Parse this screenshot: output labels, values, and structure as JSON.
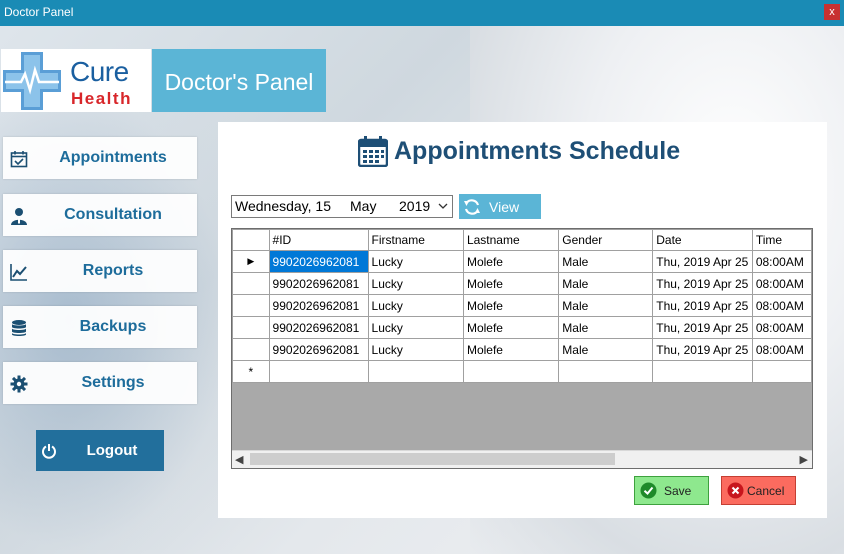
{
  "window": {
    "title": "Doctor Panel",
    "close_glyph": "x"
  },
  "logo": {
    "line1": "Cure",
    "line2": "Health",
    "icon": "medical-cross-heartbeat-icon"
  },
  "header": {
    "title": "Doctor's Panel"
  },
  "nav": {
    "items": [
      {
        "label": "Appointments",
        "icon": "calendar-check-icon"
      },
      {
        "label": "Consultation",
        "icon": "user-doctor-icon"
      },
      {
        "label": "Reports",
        "icon": "line-chart-icon"
      },
      {
        "label": "Backups",
        "icon": "database-icon"
      },
      {
        "label": "Settings",
        "icon": "gear-icon"
      }
    ],
    "logout": {
      "label": "Logout",
      "icon": "power-icon"
    }
  },
  "main": {
    "heading": "Appointments Schedule",
    "heading_icon": "calendar-icon",
    "date": {
      "day": "Wednesday, 15",
      "month": "May",
      "year": "2019"
    },
    "view_button": {
      "label": "View",
      "icon": "refresh-icon"
    },
    "grid": {
      "columns": [
        "#ID",
        "Firstname",
        "Lastname",
        "Gender",
        "Date",
        "Time"
      ],
      "rows": [
        [
          "9902026962081",
          "Lucky",
          "Molefe",
          "Male",
          "Thu, 2019 Apr 25",
          "08:00AM"
        ],
        [
          "9902026962081",
          "Lucky",
          "Molefe",
          "Male",
          "Thu, 2019 Apr 25",
          "08:00AM"
        ],
        [
          "9902026962081",
          "Lucky",
          "Molefe",
          "Male",
          "Thu, 2019 Apr 25",
          "08:00AM"
        ],
        [
          "9902026962081",
          "Lucky",
          "Molefe",
          "Male",
          "Thu, 2019 Apr 25",
          "08:00AM"
        ],
        [
          "9902026962081",
          "Lucky",
          "Molefe",
          "Male",
          "Thu, 2019 Apr 25",
          "08:00AM"
        ]
      ],
      "current_row_marker": "▶",
      "new_row_marker": "*"
    },
    "save_button": {
      "label": "Save",
      "icon": "check-circle-icon"
    },
    "cancel_button": {
      "label": "Cancel",
      "icon": "x-circle-icon"
    }
  },
  "colors": {
    "titlebar": "#1a8bb5",
    "accent": "#5bb5d6",
    "nav_text": "#1d6c9b",
    "logout": "#226f9c",
    "heading": "#1e4f76",
    "selection": "#0078d7",
    "save": "#8ee88e",
    "cancel": "#fb6b5f"
  }
}
